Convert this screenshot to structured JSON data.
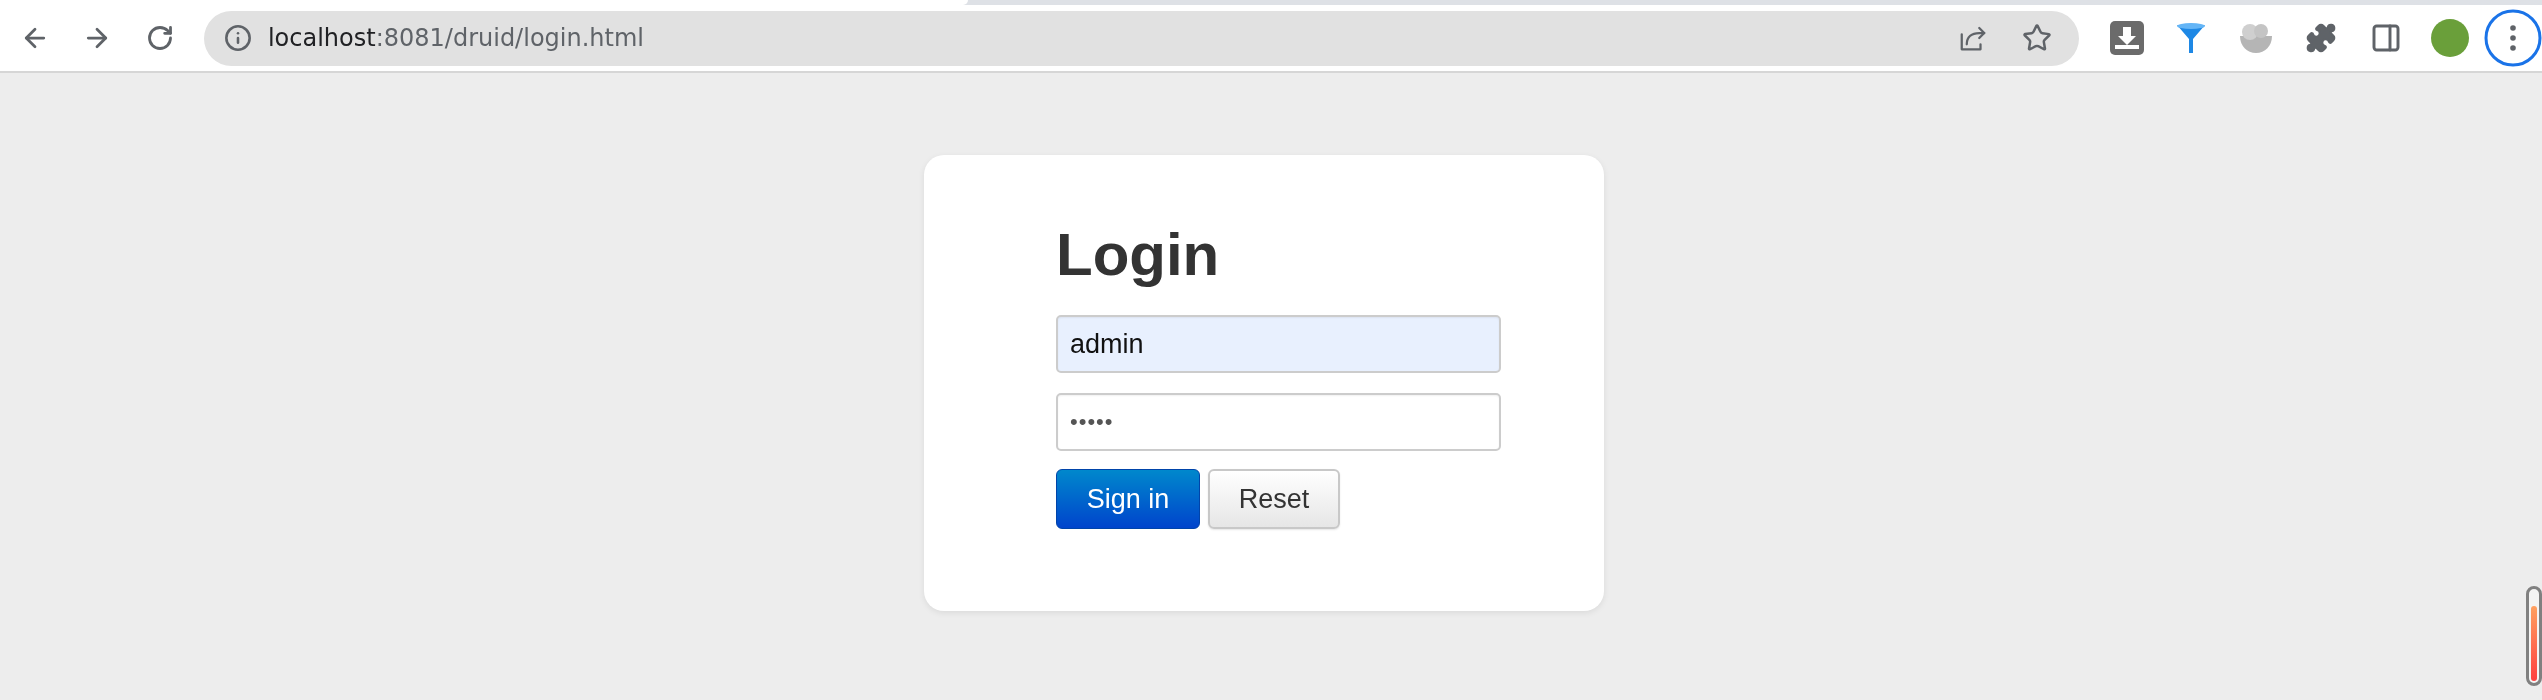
{
  "browser": {
    "address_bar": {
      "host": "localhost",
      "path": ":8081/druid/login.html"
    }
  },
  "login": {
    "title": "Login",
    "fields": [
      {
        "kind": "text",
        "value": "admin",
        "autofilled": true
      },
      {
        "kind": "password",
        "value": "•••••",
        "autofilled": false
      }
    ],
    "buttons": [
      {
        "kind": "primary",
        "label": "Sign in"
      },
      {
        "kind": "default",
        "label": "Reset"
      }
    ]
  }
}
